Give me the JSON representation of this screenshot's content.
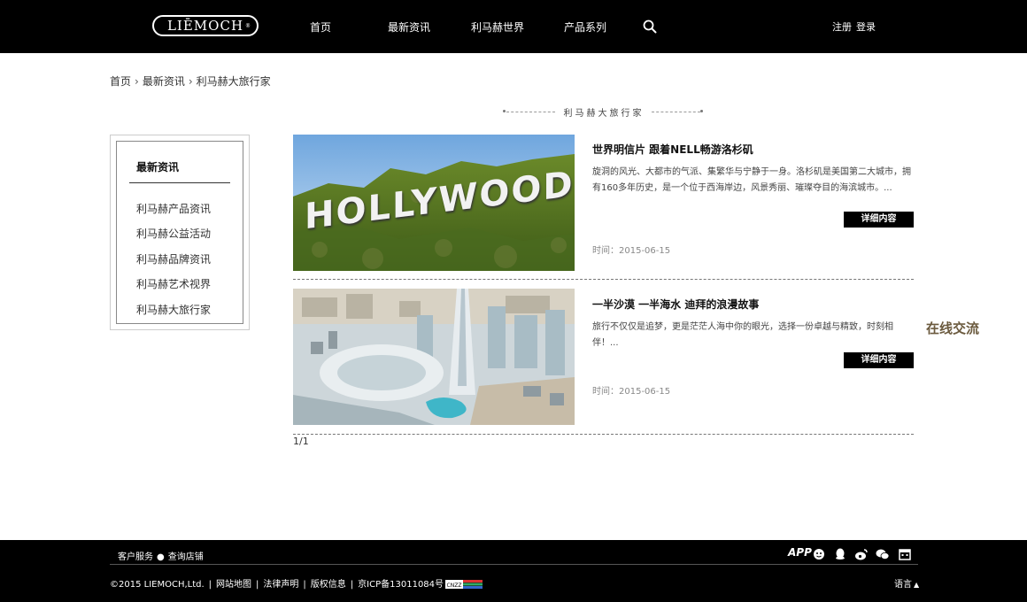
{
  "header": {
    "logo_text": "LIĒMOCH",
    "logo_mark": "®",
    "nav": [
      "首页",
      "最新资讯",
      "利马赫世界",
      "产品系列"
    ],
    "register": "注册",
    "login": "登录"
  },
  "breadcrumb": [
    "首页",
    "最新资讯",
    "利马赫大旅行家"
  ],
  "section_title": "利马赫大旅行家",
  "sidebar": {
    "title": "最新资讯",
    "items": [
      "利马赫产品资讯",
      "利马赫公益活动",
      "利马赫品牌资讯",
      "利马赫艺术视界",
      "利马赫大旅行家"
    ]
  },
  "articles": [
    {
      "image_text": "HOLLYWOOD",
      "title": "世界明信片 跟着NELL畅游洛杉矶",
      "desc": "旋洞的风光、大都市的气派、集繁华与宁静于一身。洛杉矶是美国第二大城市，拥有160多年历史，是一个位于西海岸边，风景秀丽、璀璨夺目的海滨城市。...",
      "button": "详细内容",
      "date": "时间：2015-06-15"
    },
    {
      "image_text": "",
      "title": "一半沙漠 一半海水 迪拜的浪漫故事",
      "desc": "旅行不仅仅是追梦，更是茫茫人海中你的眼光，选择一份卓越与精致，时刻相伴！...",
      "button": "详细内容",
      "date": "时间：2015-06-15"
    }
  ],
  "pager": "1/1",
  "online_chat": "在线交流",
  "footer": {
    "top_links": [
      "客户服务",
      "查询店铺"
    ],
    "copyright": "©2015 LIEMOCH,Ltd.",
    "links": [
      "网站地图",
      "法律声明",
      "版权信息",
      "京ICP备13011084号"
    ],
    "cnzz": "CNZZ",
    "app_label": "APP",
    "language": "语言"
  },
  "colors": {
    "header_bg": "#000000",
    "accent_brown": "#6b5a3e"
  }
}
